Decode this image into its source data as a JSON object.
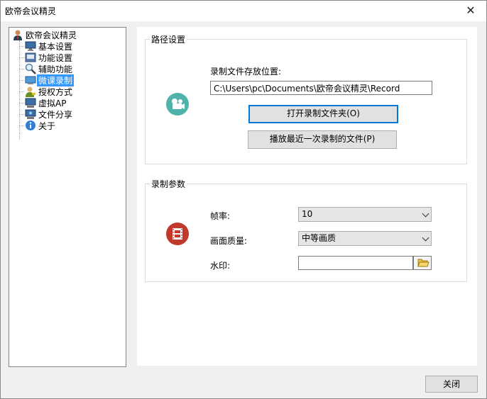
{
  "window": {
    "title": "欧帝会议精灵"
  },
  "tree": {
    "root_label": "欧帝会议精灵",
    "items": [
      {
        "label": "基本设置",
        "icon": "monitor-icon"
      },
      {
        "label": "功能设置",
        "icon": "keyboard-icon"
      },
      {
        "label": "辅助功能",
        "icon": "magnifier-icon"
      },
      {
        "label": "微课录制",
        "icon": "monitor-record-icon",
        "selected": true
      },
      {
        "label": "授权方式",
        "icon": "user-key-icon"
      },
      {
        "label": "虚拟AP",
        "icon": "network-icon"
      },
      {
        "label": "文件分享",
        "icon": "share-icon"
      },
      {
        "label": "关于",
        "icon": "info-icon"
      }
    ]
  },
  "path_group": {
    "title": "路径设置",
    "save_location_label": "录制文件存放位置:",
    "save_location_value": "C:\\Users\\pc\\Documents\\欧帝会议精灵\\Record",
    "open_folder_button": "打开录制文件夹(O)",
    "play_last_button": "播放最近一次录制的文件(P)"
  },
  "params_group": {
    "title": "录制参数",
    "frame_rate_label": "帧率:",
    "frame_rate_value": "10",
    "quality_label": "画面质量:",
    "quality_value": "中等画质",
    "watermark_label": "水印:",
    "watermark_value": ""
  },
  "footer": {
    "close_button": "关闭"
  },
  "colors": {
    "selection": "#3399ff",
    "focus_border": "#0078d7",
    "camera_icon": "#4fb3a9",
    "film_icon": "#c0392b"
  }
}
